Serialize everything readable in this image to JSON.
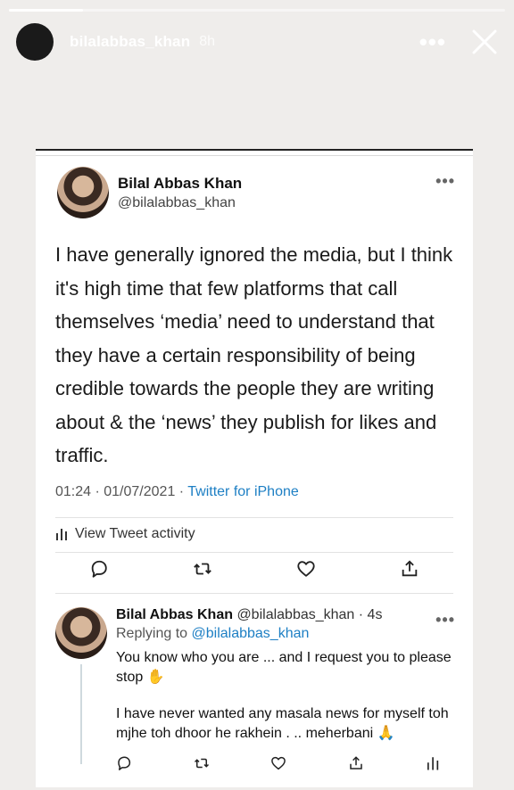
{
  "story": {
    "username": "bilalabbas_khan",
    "time": "8h",
    "more_label": "•••",
    "progress": 0.15
  },
  "tweet": {
    "display_name": "Bilal Abbas Khan",
    "handle": "@bilalabbas_khan",
    "text": "I have generally ignored the media, but I think it's high time that few platforms that call themselves ‘media’ need to understand that they have a certain responsibility of being credible towards the people they are writing about & the ‘news’ they publish for likes and traffic.",
    "time_date": "01:24 · 01/07/2021 · ",
    "source": "Twitter for iPhone",
    "activity_label": "View Tweet activity",
    "more_label": "•••"
  },
  "reply": {
    "display_name": "Bilal Abbas Khan",
    "handle_time": "@bilalabbas_khan · 4s",
    "replying_prefix": "Replying to ",
    "replying_to": "@bilalabbas_khan",
    "line1": "You know who you are ... and I request you to please stop ✋",
    "line2": "I have never wanted any masala news for myself toh mjhe toh dhoor he rakhein . .. meherbani 🙏",
    "more_label": "•••"
  },
  "icons": {
    "reply": "reply-icon",
    "retweet": "retweet-icon",
    "like": "like-icon",
    "share": "share-icon",
    "activity": "analytics-icon"
  }
}
